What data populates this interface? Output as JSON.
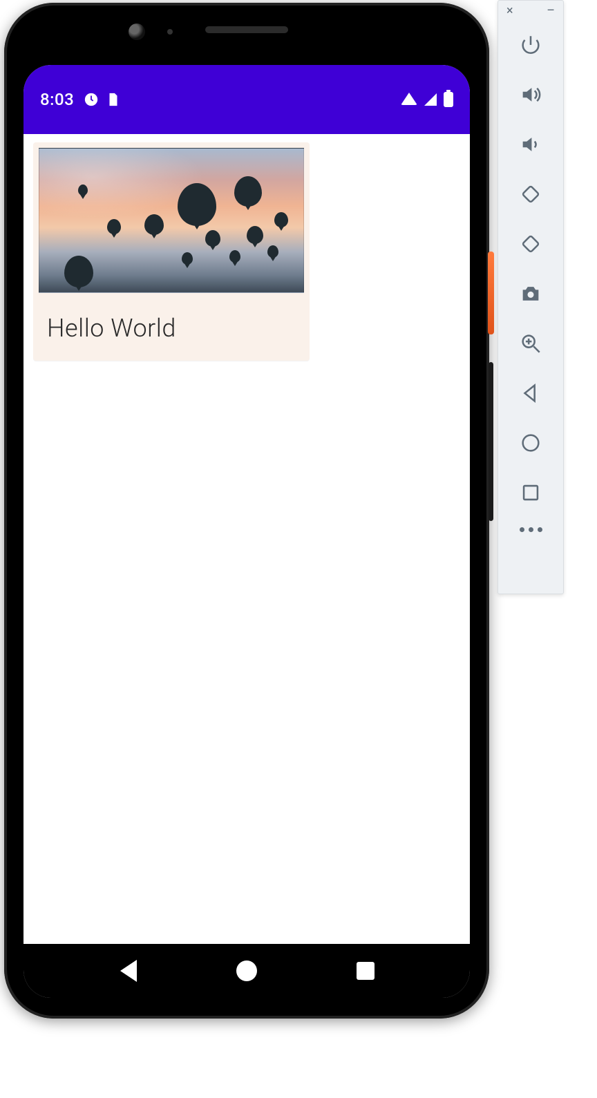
{
  "statusbar": {
    "time": "8:03",
    "left_icons": [
      "notification-icon",
      "sim-icon"
    ],
    "right_icons": [
      "wifi-icon",
      "signal-icon",
      "battery-icon"
    ]
  },
  "card": {
    "text": "Hello World",
    "image_alt": "hot-air-balloons-sunset"
  },
  "navbar": {
    "buttons": [
      "back",
      "home",
      "recent"
    ]
  },
  "emulator_toolbar": {
    "window_controls": {
      "close": "×",
      "minimize": "–"
    },
    "tools": [
      {
        "name": "power-icon",
        "label": "Power"
      },
      {
        "name": "volume-up-icon",
        "label": "Volume up"
      },
      {
        "name": "volume-down-icon",
        "label": "Volume down"
      },
      {
        "name": "rotate-left-icon",
        "label": "Rotate left"
      },
      {
        "name": "rotate-right-icon",
        "label": "Rotate right"
      },
      {
        "name": "camera-icon",
        "label": "Take screenshot"
      },
      {
        "name": "zoom-icon",
        "label": "Zoom"
      },
      {
        "name": "back-icon",
        "label": "Back"
      },
      {
        "name": "home-icon",
        "label": "Home"
      },
      {
        "name": "overview-icon",
        "label": "Overview"
      }
    ],
    "more": "more-icon"
  }
}
